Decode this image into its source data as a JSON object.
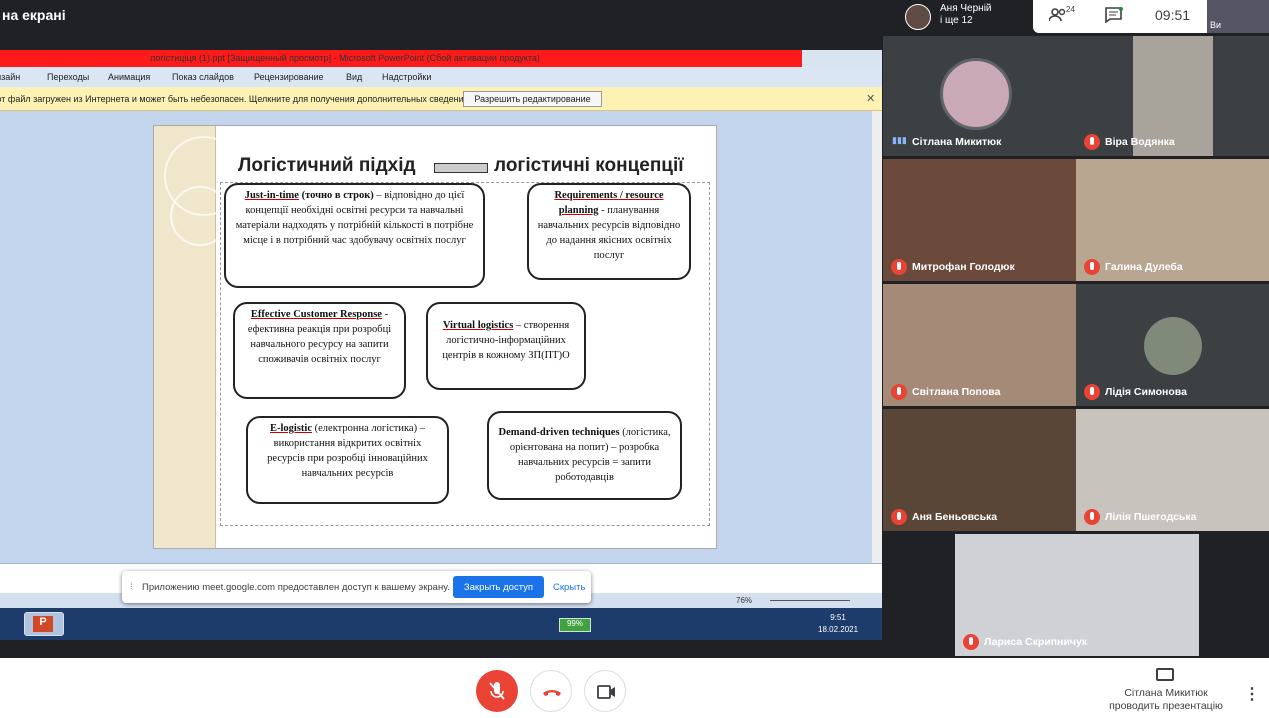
{
  "meet": {
    "presenting_title": "на екрані",
    "owner_name": "Аня Черній",
    "owner_extra": "і ще 12",
    "participant_count": "24",
    "clock": "09:51",
    "self_label": "Ви"
  },
  "powerpoint": {
    "window_title": "логістиціця (1).ppt [Защищенный просмотр]  -  Microsoft PowerPoint (Сбой активации продукта)",
    "ribbon_tabs": [
      "Дизайн",
      "Переходы",
      "Анимация",
      "Показ слайдов",
      "Рецензирование",
      "Вид",
      "Надстройки"
    ],
    "warning_text": "Этот файл загружен из Интернета и может быть небезопасен. Щелкните для получения дополнительных сведений.",
    "enable_edit_label": "Разрешить редактирование",
    "zoom": "76%",
    "taskbar_time": "9:51",
    "taskbar_date": "18.02.2021",
    "battery": "99%"
  },
  "slide": {
    "title_left": "Логістичний підхід",
    "title_right": "логістичні концепції",
    "boxes": [
      {
        "head": "Just-in-time",
        "extra": " (точно в строк)",
        "body": " – відповідно до цієї концепції необхідні освітні ресурси та навчальні матеріали надходять у потрібній кількості в потрібне місце і в потрібний час здобувачу освітніх послуг"
      },
      {
        "head": "Requirements / resource planning",
        "extra": "",
        "body": " - планування навчальних ресурсів відповідно до надання якісних освітніх послуг"
      },
      {
        "head": "Effective Customer Response",
        "extra": "",
        "body": " - ефективна реакція при розробці навчального ресурсу на запити споживачів освітніх послуг"
      },
      {
        "head": "Virtual logistics",
        "extra": "",
        "body": " – створення логістично-інформаційних центрів в кожному ЗП(ПТ)О"
      },
      {
        "head": "E-logistic",
        "extra": "",
        "body": " (електронна логістика) – використання відкритих освітніх ресурсів при розробці інноваційних навчальних ресурсів"
      },
      {
        "head": "Demand-driven techniques",
        "extra": "",
        "body": " (логістика, орієнтована на попит) – розробка навчальних ресурсів = запити роботодавців"
      }
    ]
  },
  "share_notice": {
    "text": "Приложению meet.google.com предоставлен доступ к вашему экрану.",
    "stop_label": "Закрыть доступ",
    "hide_label": "Скрыть"
  },
  "participants": [
    {
      "name": "Сітлана Микитюк"
    },
    {
      "name": "Віра Водянка"
    },
    {
      "name": "Митрофан Голодюк"
    },
    {
      "name": "Галина Дулеба"
    },
    {
      "name": "Світлана Попова"
    },
    {
      "name": "Лідія Симонова"
    },
    {
      "name": "Аня Беньовська"
    },
    {
      "name": "Лілія Пшегодська"
    },
    {
      "name": "Лариса Скрипничук"
    }
  ],
  "bottom": {
    "presenter_line1": "Сітлана Микитюк",
    "presenter_line2": "проводить презентацію"
  },
  "colors": {
    "mute_red": "#ea4335",
    "meet_blue": "#1a73e8"
  }
}
